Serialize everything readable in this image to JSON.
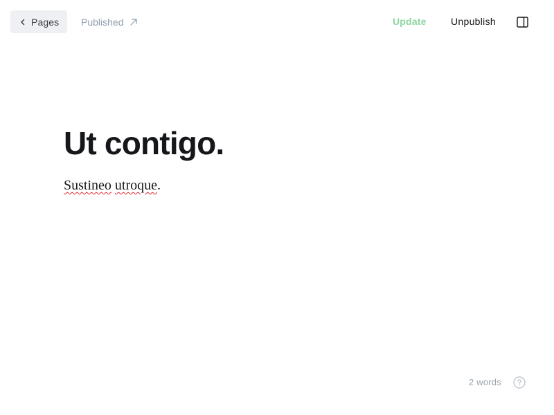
{
  "header": {
    "back_label": "Pages",
    "status_label": "Published",
    "update_label": "Update",
    "unpublish_label": "Unpublish",
    "icons": {
      "back": "chevron-left-icon",
      "status": "external-link-arrow-icon",
      "sidebar": "sidebar-toggle-icon"
    }
  },
  "editor": {
    "title": "Ut contigo.",
    "body_words": [
      "Sustineo",
      "utroque"
    ],
    "body_separator": " ",
    "body_end": "."
  },
  "footer": {
    "word_count": "2 words",
    "help_icon": "question-circle-icon"
  },
  "colors": {
    "update": "#8ed6a0",
    "back_button_bg": "#eef0f3",
    "muted": "#8e9cac",
    "spellcheck": "#e0282e"
  }
}
